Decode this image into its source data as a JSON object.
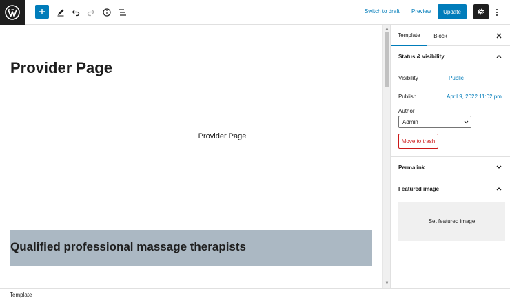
{
  "toolbar": {
    "switch_to_draft": "Switch to draft",
    "preview": "Preview",
    "update": "Update"
  },
  "editor": {
    "page_title": "Provider Page",
    "paragraph": "Provider Page",
    "cover_heading": "Qualified professional massage therapists",
    "cover_color": "#abb8c3"
  },
  "sidebar": {
    "tabs": [
      {
        "label": "Template",
        "active": true
      },
      {
        "label": "Block",
        "active": false
      }
    ],
    "status_visibility": {
      "title": "Status & visibility",
      "visibility_label": "Visibility",
      "visibility_value": "Public",
      "publish_label": "Publish",
      "publish_value": "April 9, 2022 11:02 pm",
      "author_label": "Author",
      "author_value": "Admin",
      "trash_label": "Move to trash"
    },
    "permalink": {
      "title": "Permalink"
    },
    "featured_image": {
      "title": "Featured image",
      "set_label": "Set featured image"
    }
  },
  "footer": {
    "breadcrumb": "Template"
  },
  "colors": {
    "accent": "#007cba",
    "danger": "#cc1818",
    "dark": "#1e1e1e"
  }
}
